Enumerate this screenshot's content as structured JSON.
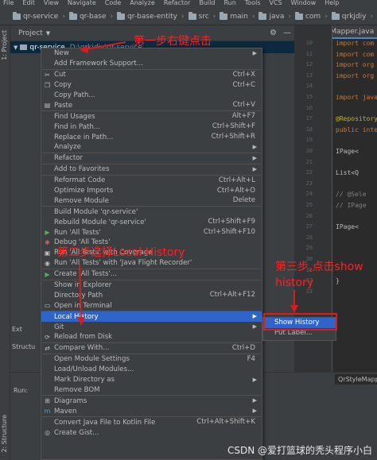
{
  "menubar": [
    "File",
    "Edit",
    "View",
    "Navigate",
    "Code",
    "Analyze",
    "Refactor",
    "Build",
    "Run",
    "Tools",
    "VCS",
    "Window",
    "Help"
  ],
  "breadcrumbs": [
    "qr-service",
    "qr-base",
    "qr-base-entity",
    "src",
    "main",
    "java",
    "com",
    "qrkjdiy"
  ],
  "project_panel": {
    "title": "Project",
    "root_item": "qr-service",
    "root_path": "D:\\qrkjdiy\\qr-service"
  },
  "left_tabs": [
    "1: Project",
    "Structure",
    "2: Structure"
  ],
  "editor": {
    "tab": "QrStyleMapper.java",
    "bottom_tab": "QrStyleMapper",
    "lines": [
      "import com",
      "import com",
      "import org",
      "import org",
      "",
      "import java",
      "",
      "@Repository",
      "public inte",
      "",
      "IPage<",
      "",
      "List<Q",
      "",
      "//  @Sele",
      "//  IPage",
      "",
      "IPage<",
      "",
      "",
      "",
      "",
      "}"
    ],
    "line_numbers": [
      "10",
      "11",
      "12",
      "13",
      "14",
      "15",
      "16",
      "17",
      "18",
      "19",
      "20",
      "21",
      "22",
      "23",
      "24",
      "25",
      "26",
      "27",
      "28",
      "29",
      "30",
      "31",
      "32",
      "33"
    ]
  },
  "side_labels": [
    "Ext",
    "Structu",
    "Q",
    "Run:"
  ],
  "context_menu": {
    "items": [
      {
        "label": "New",
        "submenu": true
      },
      {
        "label": "Add Framework Support..."
      },
      {
        "sep": true
      },
      {
        "label": "Cut",
        "shortcut": "Ctrl+X",
        "icon": "cut-icon",
        "glyph": "✂"
      },
      {
        "label": "Copy",
        "shortcut": "Ctrl+C",
        "icon": "copy-icon",
        "glyph": "❐"
      },
      {
        "label": "Copy Path...",
        "shortcut": ""
      },
      {
        "label": "Paste",
        "shortcut": "Ctrl+V",
        "icon": "paste-icon",
        "glyph": "▤"
      },
      {
        "sep": true
      },
      {
        "label": "Find Usages",
        "shortcut": "Alt+F7"
      },
      {
        "label": "Find in Path...",
        "shortcut": "Ctrl+Shift+F"
      },
      {
        "label": "Replace in Path...",
        "shortcut": "Ctrl+Shift+R"
      },
      {
        "label": "Analyze",
        "submenu": true
      },
      {
        "sep": true
      },
      {
        "label": "Refactor",
        "submenu": true
      },
      {
        "sep": true
      },
      {
        "label": "Add to Favorites",
        "submenu": true
      },
      {
        "sep": true
      },
      {
        "label": "Reformat Code",
        "shortcut": "Ctrl+Alt+L"
      },
      {
        "label": "Optimize Imports",
        "shortcut": "Ctrl+Alt+O"
      },
      {
        "label": "Remove Module",
        "shortcut": "Delete"
      },
      {
        "sep": true
      },
      {
        "label": "Build Module 'qr-service'"
      },
      {
        "label": "Rebuild Module 'qr-service'",
        "shortcut": "Ctrl+Shift+F9"
      },
      {
        "label": "Run 'All Tests'",
        "shortcut": "Ctrl+Shift+F10",
        "icon": "run-icon",
        "glyph": "▶"
      },
      {
        "label": "Debug 'All Tests'",
        "icon": "debug-icon",
        "glyph": "✱"
      },
      {
        "label": "Run 'All Tests' with Coverage",
        "icon": "coverage-icon",
        "glyph": "▣"
      },
      {
        "label": "Run 'All Tests' with 'Java Flight Recorder'",
        "icon": "jfr-icon",
        "glyph": "◉"
      },
      {
        "sep": true
      },
      {
        "label": "Create 'All Tests'...",
        "icon": "create-test-icon",
        "glyph": "▶"
      },
      {
        "sep": true
      },
      {
        "label": "Show in Explorer"
      },
      {
        "label": "Directory Path",
        "shortcut": "Ctrl+Alt+F12"
      },
      {
        "label": "Open in Terminal",
        "icon": "terminal-icon",
        "glyph": "▭"
      },
      {
        "sep": true
      },
      {
        "label": "Local History",
        "submenu": true,
        "highlighted": true
      },
      {
        "label": "Git",
        "submenu": true
      },
      {
        "label": "Reload from Disk",
        "icon": "reload-icon",
        "glyph": "⟳"
      },
      {
        "sep": true
      },
      {
        "label": "Compare With...",
        "shortcut": "Ctrl+D",
        "icon": "compare-icon",
        "glyph": "⇄"
      },
      {
        "sep": true
      },
      {
        "label": "Open Module Settings",
        "shortcut": "F4"
      },
      {
        "label": "Load/Unload Modules..."
      },
      {
        "label": "Mark Directory as",
        "submenu": true
      },
      {
        "label": "Remove BOM"
      },
      {
        "sep": true
      },
      {
        "label": "Diagrams",
        "submenu": true,
        "icon": "diagram-icon",
        "glyph": "⊞"
      },
      {
        "label": "Maven",
        "submenu": true,
        "icon": "maven-icon",
        "glyph": "m"
      },
      {
        "sep": true
      },
      {
        "label": "Convert Java File to Kotlin File",
        "shortcut": "Ctrl+Alt+Shift+K"
      },
      {
        "label": "Create Gist...",
        "icon": "gist-icon",
        "glyph": "◎"
      }
    ]
  },
  "submenu": {
    "items": [
      {
        "label": "Show History",
        "highlighted": true
      },
      {
        "label": "Put Label..."
      }
    ]
  },
  "annotations": {
    "step1": "第一步右键点击",
    "step2": "第二步选择Local History",
    "step3_line1": "第三步,点击show",
    "step3_line2": "history"
  },
  "watermark": "CSDN @爱打篮球的秃头程序小白",
  "colors": {
    "accent": "#2f65ca",
    "annotation_red": "#ff2020",
    "background": "#2b2b2b",
    "panel": "#3c3f41"
  }
}
